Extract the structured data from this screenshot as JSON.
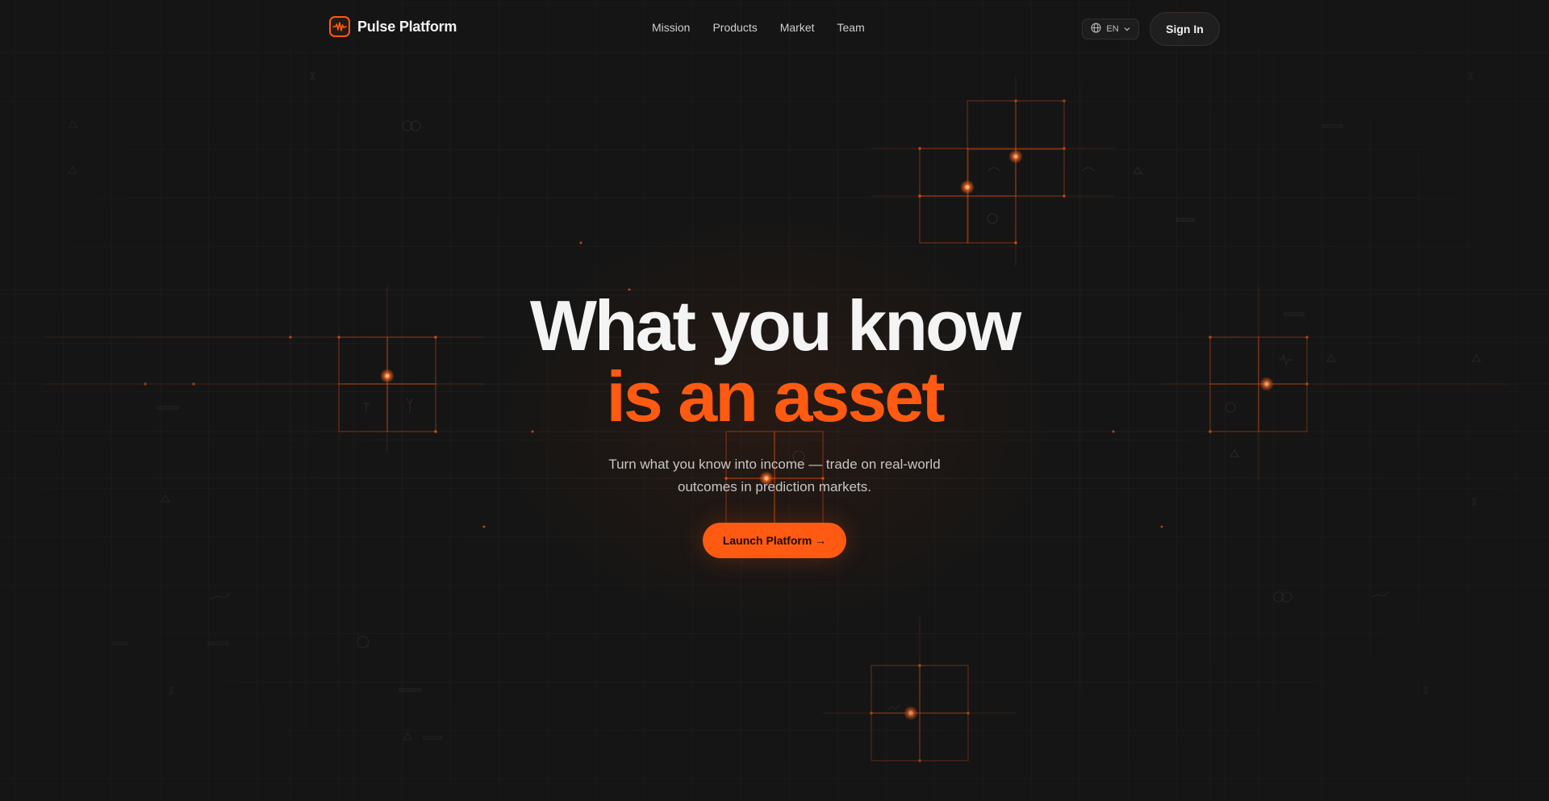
{
  "brand": {
    "name": "Pulse Platform",
    "accent": "#ff5a12",
    "logo_icon": "pulse-waveform-icon"
  },
  "nav": {
    "items": [
      {
        "label": "Mission"
      },
      {
        "label": "Products"
      },
      {
        "label": "Market"
      },
      {
        "label": "Team"
      }
    ]
  },
  "header": {
    "language": {
      "label": "EN",
      "icon": "globe-icon",
      "chevron": "chevron-down-icon"
    },
    "signin_label": "Sign In"
  },
  "hero": {
    "title_line1": "What you know",
    "title_line2": "is an asset",
    "subtitle": "Turn what you know into income — trade on real-world outcomes in prediction markets.",
    "cta_label": "Launch Platform →"
  },
  "colors": {
    "background": "#151515",
    "accent": "#ff5a12",
    "text_primary": "#f4f4f4",
    "text_secondary": "#c6c6c6"
  }
}
